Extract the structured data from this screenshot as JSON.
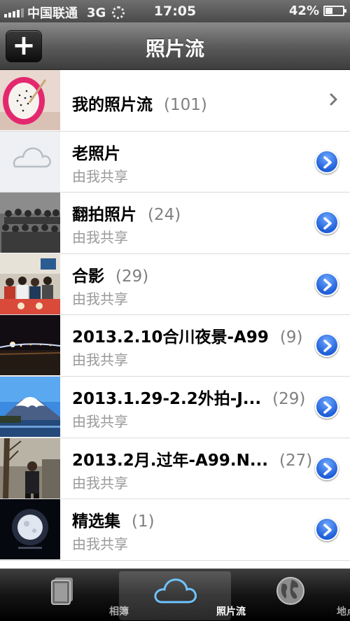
{
  "status_bar": {
    "carrier": "中国联通",
    "network": "3G",
    "time": "17:05",
    "battery_percent_label": "42%",
    "battery_level": 0.42
  },
  "nav_bar": {
    "add_button_label": "+",
    "title": "照片流"
  },
  "photo_streams": [
    {
      "name": "我的照片流",
      "count": "(101)",
      "subtitle": "",
      "accessory": "chevron",
      "thumb": "dragonfruit"
    },
    {
      "name": "老照片",
      "count": "",
      "subtitle": "由我共享",
      "accessory": "disclosure",
      "thumb": "cloud-placeholder"
    },
    {
      "name": "翻拍照片",
      "count": "(24)",
      "subtitle": "由我共享",
      "accessory": "disclosure",
      "thumb": "group-bw"
    },
    {
      "name": "合影",
      "count": "(29)",
      "subtitle": "由我共享",
      "accessory": "disclosure",
      "thumb": "family-table"
    },
    {
      "name": "2013.2.10合川夜景-A99",
      "count": "(9)",
      "subtitle": "由我共享",
      "accessory": "disclosure",
      "thumb": "night-bridge"
    },
    {
      "name": "2013.1.29-2.2外拍-J...",
      "count": "(29)",
      "subtitle": "由我共享",
      "accessory": "disclosure",
      "thumb": "mount-fuji"
    },
    {
      "name": "2013.2月.过年-A99.N...",
      "count": "(27)",
      "subtitle": "由我共享",
      "accessory": "disclosure",
      "thumb": "person-tree"
    },
    {
      "name": "精选集",
      "count": "(1)",
      "subtitle": "由我共享",
      "accessory": "disclosure",
      "thumb": "moon"
    }
  ],
  "tab_bar": {
    "tabs": [
      {
        "label": "相簿",
        "icon": "albums-icon",
        "active": false
      },
      {
        "label": "照片流",
        "icon": "cloud-icon",
        "active": true
      },
      {
        "label": "地点",
        "icon": "globe-icon",
        "active": false
      }
    ]
  },
  "colors": {
    "disclosure_blue": "#1f5fd8",
    "subtitle_gray": "#9a9a9a",
    "count_gray": "#808080"
  }
}
